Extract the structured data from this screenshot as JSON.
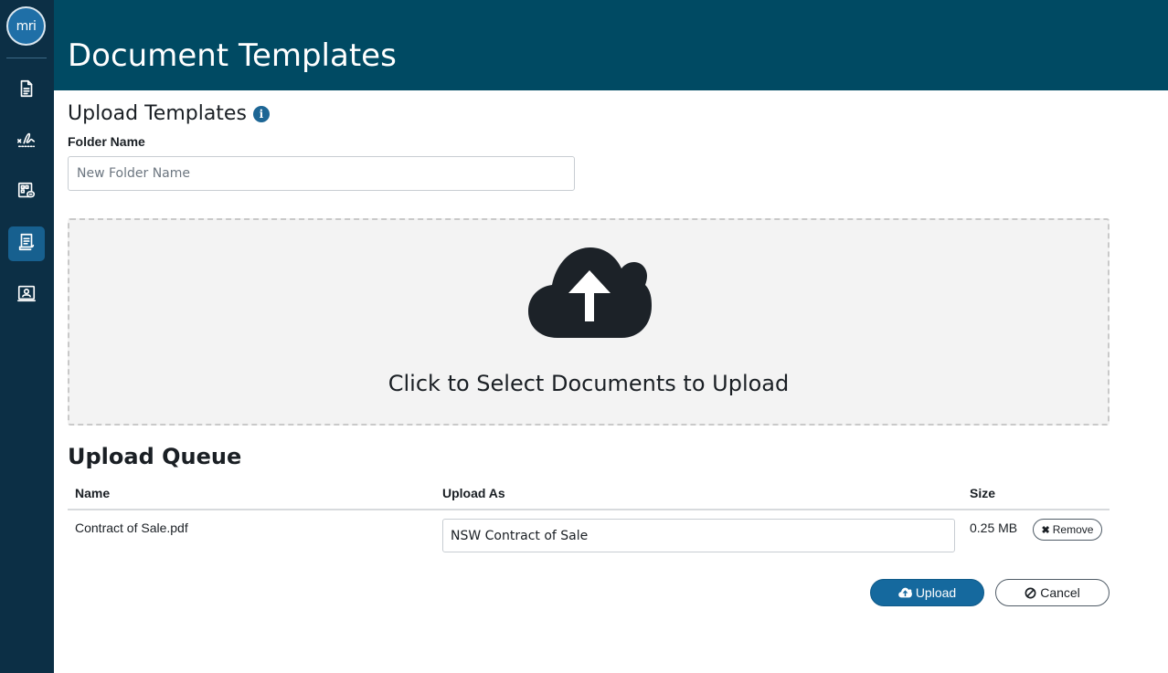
{
  "app": {
    "logo_text": "mri",
    "page_title": "Document Templates"
  },
  "sidebar": {
    "items": [
      {
        "icon": "document-icon",
        "active": false
      },
      {
        "icon": "signature-icon",
        "active": false
      },
      {
        "icon": "template-link-icon",
        "active": false
      },
      {
        "icon": "document-templates-icon",
        "active": true
      },
      {
        "icon": "contact-card-icon",
        "active": false
      }
    ]
  },
  "upload": {
    "section_title": "Upload Templates",
    "info_icon": "info-icon",
    "folder_label": "Folder Name",
    "folder_placeholder": "New Folder Name",
    "folder_value": "",
    "dropzone_text": "Click to Select Documents to Upload",
    "dropzone_icon": "cloud-upload-icon"
  },
  "queue": {
    "title": "Upload Queue",
    "columns": {
      "name": "Name",
      "upload_as": "Upload As",
      "size": "Size"
    },
    "rows": [
      {
        "name": "Contract of Sale.pdf",
        "upload_as": "NSW Contract of Sale",
        "size": "0.25 MB",
        "remove_label": "Remove"
      }
    ]
  },
  "actions": {
    "upload_label": "Upload",
    "cancel_label": "Cancel"
  },
  "colors": {
    "sidebar_bg": "#0c2f45",
    "header_bg": "#004a63",
    "accent": "#15699e"
  }
}
